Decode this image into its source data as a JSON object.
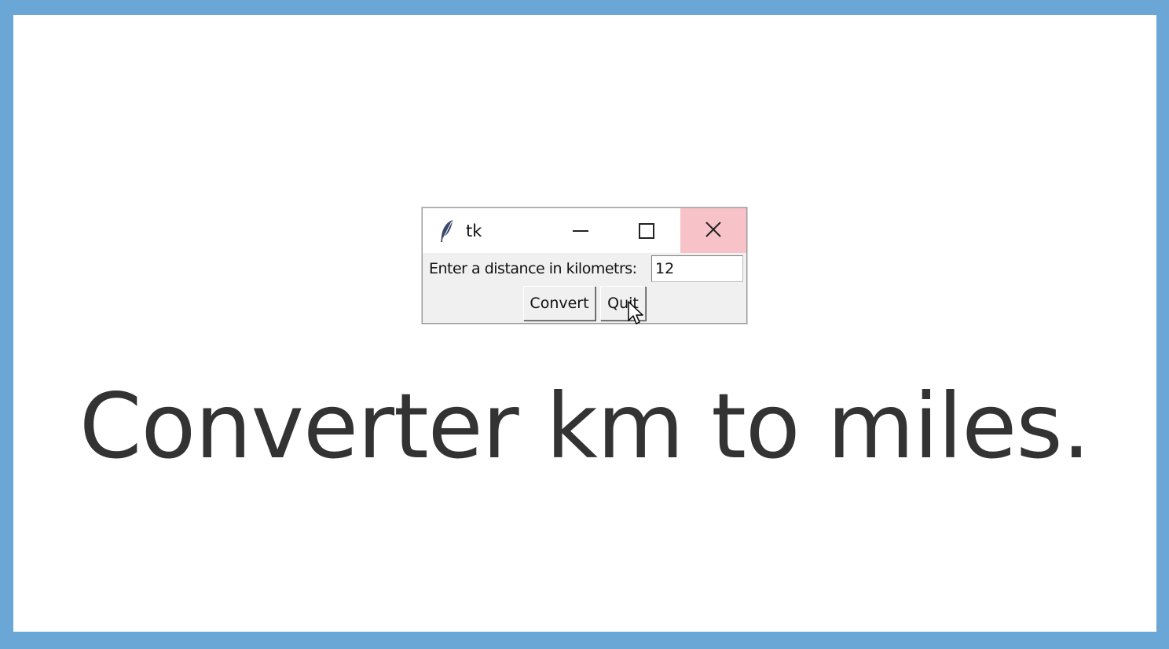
{
  "window": {
    "title": "tk",
    "icon": "feather-icon",
    "controls": [
      "minimize-icon",
      "maximize-icon",
      "close-icon"
    ]
  },
  "form": {
    "label": "Enter a distance in kilometrs:",
    "input_value": "12"
  },
  "buttons": {
    "convert_label": "Convert",
    "quit_label": "Quit"
  },
  "caption": "Converter km to miles.",
  "colors": {
    "border": "#6aa6d6",
    "close_hover": "#f7c3c8",
    "caption_text": "#333333"
  }
}
